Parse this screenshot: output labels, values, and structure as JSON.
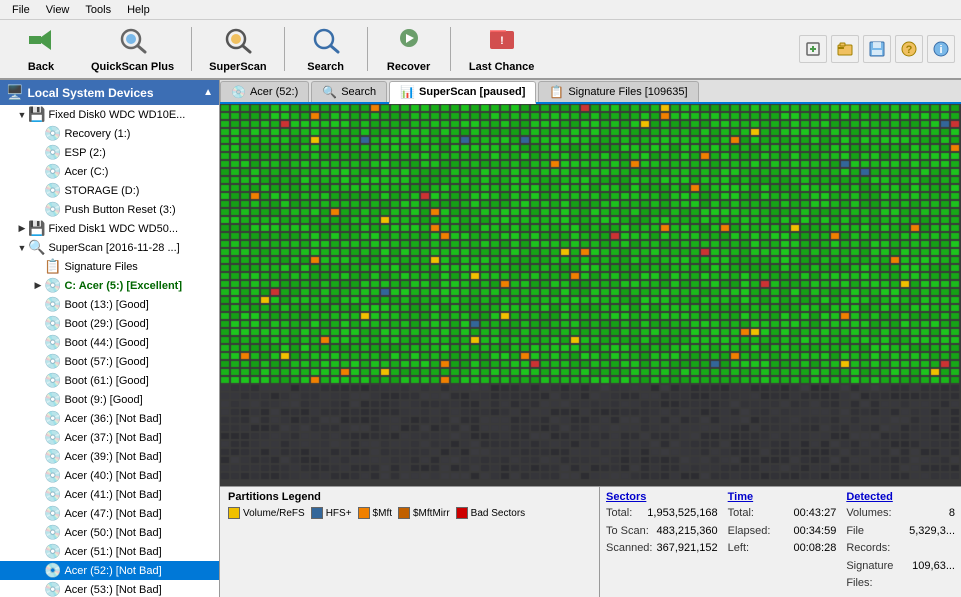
{
  "menu": {
    "items": [
      "File",
      "View",
      "Tools",
      "Help"
    ]
  },
  "toolbar": {
    "back_label": "Back",
    "quickscan_label": "QuickScan Plus",
    "superscan_label": "SuperScan",
    "search_label": "Search",
    "recover_label": "Recover",
    "lastchance_label": "Last Chance"
  },
  "panel_header": "Local System Devices",
  "tree": [
    {
      "id": "fixed0",
      "label": "Fixed Disk0 WDC WD10E...",
      "indent": 16,
      "icon": "💾",
      "toggle": "▼",
      "level": 1
    },
    {
      "id": "recovery",
      "label": "Recovery (1:)",
      "indent": 32,
      "icon": "💿",
      "toggle": "",
      "level": 2
    },
    {
      "id": "esp",
      "label": "ESP (2:)",
      "indent": 32,
      "icon": "💿",
      "toggle": "",
      "level": 2
    },
    {
      "id": "acer_c",
      "label": "Acer (C:)",
      "indent": 32,
      "icon": "💿",
      "toggle": "",
      "level": 2
    },
    {
      "id": "storage_d",
      "label": "STORAGE (D:)",
      "indent": 32,
      "icon": "💿",
      "toggle": "",
      "level": 2
    },
    {
      "id": "pushbtn",
      "label": "Push Button Reset (3:)",
      "indent": 32,
      "icon": "💿",
      "toggle": "",
      "level": 2
    },
    {
      "id": "fixed1",
      "label": "Fixed Disk1 WDC WD50...",
      "indent": 16,
      "icon": "💾",
      "toggle": "▶",
      "level": 1
    },
    {
      "id": "superscan",
      "label": "SuperScan [2016-11-28 ...]",
      "indent": 16,
      "icon": "🔍",
      "toggle": "▼",
      "level": 1
    },
    {
      "id": "sigfiles",
      "label": "Signature Files",
      "indent": 32,
      "icon": "📋",
      "toggle": "",
      "level": 2
    },
    {
      "id": "c_acer5",
      "label": "C: Acer (5:) [Excellent]",
      "indent": 32,
      "icon": "💿",
      "toggle": "▶",
      "level": 2,
      "bold": true
    },
    {
      "id": "boot13",
      "label": "Boot (13:) [Good]",
      "indent": 32,
      "icon": "💿",
      "toggle": "",
      "level": 2
    },
    {
      "id": "boot29",
      "label": "Boot (29:) [Good]",
      "indent": 32,
      "icon": "💿",
      "toggle": "",
      "level": 2
    },
    {
      "id": "boot44",
      "label": "Boot (44:) [Good]",
      "indent": 32,
      "icon": "💿",
      "toggle": "",
      "level": 2
    },
    {
      "id": "boot57",
      "label": "Boot (57:) [Good]",
      "indent": 32,
      "icon": "💿",
      "toggle": "",
      "level": 2
    },
    {
      "id": "boot61",
      "label": "Boot (61:) [Good]",
      "indent": 32,
      "icon": "💿",
      "toggle": "",
      "level": 2
    },
    {
      "id": "boot9",
      "label": "Boot (9:) [Good]",
      "indent": 32,
      "icon": "💿",
      "toggle": "",
      "level": 2
    },
    {
      "id": "acer36",
      "label": "Acer (36:) [Not Bad]",
      "indent": 32,
      "icon": "💿",
      "toggle": "",
      "level": 2
    },
    {
      "id": "acer37",
      "label": "Acer (37:) [Not Bad]",
      "indent": 32,
      "icon": "💿",
      "toggle": "",
      "level": 2
    },
    {
      "id": "acer39",
      "label": "Acer (39:) [Not Bad]",
      "indent": 32,
      "icon": "💿",
      "toggle": "",
      "level": 2
    },
    {
      "id": "acer40",
      "label": "Acer (40:) [Not Bad]",
      "indent": 32,
      "icon": "💿",
      "toggle": "",
      "level": 2
    },
    {
      "id": "acer41",
      "label": "Acer (41:) [Not Bad]",
      "indent": 32,
      "icon": "💿",
      "toggle": "",
      "level": 2
    },
    {
      "id": "acer47",
      "label": "Acer (47:) [Not Bad]",
      "indent": 32,
      "icon": "💿",
      "toggle": "",
      "level": 2
    },
    {
      "id": "acer50",
      "label": "Acer (50:) [Not Bad]",
      "indent": 32,
      "icon": "💿",
      "toggle": "",
      "level": 2
    },
    {
      "id": "acer51",
      "label": "Acer (51:) [Not Bad]",
      "indent": 32,
      "icon": "💿",
      "toggle": "",
      "level": 2
    },
    {
      "id": "acer52",
      "label": "Acer (52:) [Not Bad]",
      "indent": 32,
      "icon": "💿",
      "toggle": "",
      "level": 2,
      "selected": true
    },
    {
      "id": "acer53",
      "label": "Acer (53:) [Not Bad]",
      "indent": 32,
      "icon": "💿",
      "toggle": "",
      "level": 2
    }
  ],
  "tabs": [
    {
      "id": "acer52",
      "label": "Acer (52:)",
      "icon": "💿",
      "active": false
    },
    {
      "id": "search",
      "label": "Search",
      "icon": "🔍",
      "active": false
    },
    {
      "id": "superscan",
      "label": "SuperScan [paused]",
      "icon": "📊",
      "active": true
    },
    {
      "id": "sigfiles",
      "label": "Signature Files [109635]",
      "icon": "📋",
      "active": false
    }
  ],
  "legend": {
    "title": "Partitions Legend",
    "items": [
      {
        "label": "Volume/ReFS",
        "color": "#f0c000"
      },
      {
        "label": "HFS+",
        "color": "#336699"
      },
      {
        "label": "$Mft",
        "color": "#f08000"
      },
      {
        "label": "$MftMirr",
        "color": "#c06000"
      },
      {
        "label": "Bad Sectors",
        "color": "#cc0000"
      }
    ]
  },
  "stats": {
    "sectors": {
      "header": "Sectors",
      "rows": [
        {
          "label": "Total:",
          "value": "1,953,525,168"
        },
        {
          "label": "To Scan:",
          "value": "483,215,360"
        },
        {
          "label": "Scanned:",
          "value": "367,921,152"
        }
      ]
    },
    "time": {
      "header": "Time",
      "rows": [
        {
          "label": "Total:",
          "value": "00:43:27"
        },
        {
          "label": "Elapsed:",
          "value": "00:34:59"
        },
        {
          "label": "Left:",
          "value": "00:08:28"
        }
      ]
    },
    "detected": {
      "header": "Detected",
      "rows": [
        {
          "label": "Volumes:",
          "value": "8"
        },
        {
          "label": "File Records:",
          "value": "5,329,3..."
        },
        {
          "label": "Signature Files:",
          "value": "109,63..."
        }
      ]
    }
  }
}
